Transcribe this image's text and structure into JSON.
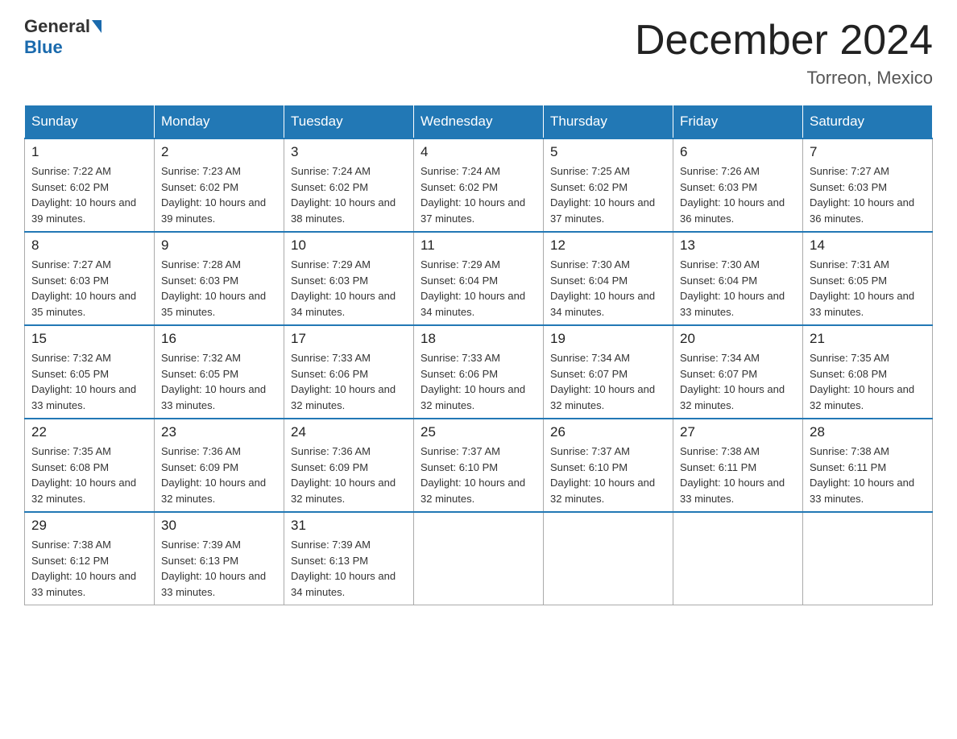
{
  "header": {
    "logo_general": "General",
    "logo_blue": "Blue",
    "month_title": "December 2024",
    "location": "Torreon, Mexico"
  },
  "weekdays": [
    "Sunday",
    "Monday",
    "Tuesday",
    "Wednesday",
    "Thursday",
    "Friday",
    "Saturday"
  ],
  "weeks": [
    [
      {
        "day": 1,
        "sunrise": "7:22 AM",
        "sunset": "6:02 PM",
        "daylight": "10 hours and 39 minutes."
      },
      {
        "day": 2,
        "sunrise": "7:23 AM",
        "sunset": "6:02 PM",
        "daylight": "10 hours and 39 minutes."
      },
      {
        "day": 3,
        "sunrise": "7:24 AM",
        "sunset": "6:02 PM",
        "daylight": "10 hours and 38 minutes."
      },
      {
        "day": 4,
        "sunrise": "7:24 AM",
        "sunset": "6:02 PM",
        "daylight": "10 hours and 37 minutes."
      },
      {
        "day": 5,
        "sunrise": "7:25 AM",
        "sunset": "6:02 PM",
        "daylight": "10 hours and 37 minutes."
      },
      {
        "day": 6,
        "sunrise": "7:26 AM",
        "sunset": "6:03 PM",
        "daylight": "10 hours and 36 minutes."
      },
      {
        "day": 7,
        "sunrise": "7:27 AM",
        "sunset": "6:03 PM",
        "daylight": "10 hours and 36 minutes."
      }
    ],
    [
      {
        "day": 8,
        "sunrise": "7:27 AM",
        "sunset": "6:03 PM",
        "daylight": "10 hours and 35 minutes."
      },
      {
        "day": 9,
        "sunrise": "7:28 AM",
        "sunset": "6:03 PM",
        "daylight": "10 hours and 35 minutes."
      },
      {
        "day": 10,
        "sunrise": "7:29 AM",
        "sunset": "6:03 PM",
        "daylight": "10 hours and 34 minutes."
      },
      {
        "day": 11,
        "sunrise": "7:29 AM",
        "sunset": "6:04 PM",
        "daylight": "10 hours and 34 minutes."
      },
      {
        "day": 12,
        "sunrise": "7:30 AM",
        "sunset": "6:04 PM",
        "daylight": "10 hours and 34 minutes."
      },
      {
        "day": 13,
        "sunrise": "7:30 AM",
        "sunset": "6:04 PM",
        "daylight": "10 hours and 33 minutes."
      },
      {
        "day": 14,
        "sunrise": "7:31 AM",
        "sunset": "6:05 PM",
        "daylight": "10 hours and 33 minutes."
      }
    ],
    [
      {
        "day": 15,
        "sunrise": "7:32 AM",
        "sunset": "6:05 PM",
        "daylight": "10 hours and 33 minutes."
      },
      {
        "day": 16,
        "sunrise": "7:32 AM",
        "sunset": "6:05 PM",
        "daylight": "10 hours and 33 minutes."
      },
      {
        "day": 17,
        "sunrise": "7:33 AM",
        "sunset": "6:06 PM",
        "daylight": "10 hours and 32 minutes."
      },
      {
        "day": 18,
        "sunrise": "7:33 AM",
        "sunset": "6:06 PM",
        "daylight": "10 hours and 32 minutes."
      },
      {
        "day": 19,
        "sunrise": "7:34 AM",
        "sunset": "6:07 PM",
        "daylight": "10 hours and 32 minutes."
      },
      {
        "day": 20,
        "sunrise": "7:34 AM",
        "sunset": "6:07 PM",
        "daylight": "10 hours and 32 minutes."
      },
      {
        "day": 21,
        "sunrise": "7:35 AM",
        "sunset": "6:08 PM",
        "daylight": "10 hours and 32 minutes."
      }
    ],
    [
      {
        "day": 22,
        "sunrise": "7:35 AM",
        "sunset": "6:08 PM",
        "daylight": "10 hours and 32 minutes."
      },
      {
        "day": 23,
        "sunrise": "7:36 AM",
        "sunset": "6:09 PM",
        "daylight": "10 hours and 32 minutes."
      },
      {
        "day": 24,
        "sunrise": "7:36 AM",
        "sunset": "6:09 PM",
        "daylight": "10 hours and 32 minutes."
      },
      {
        "day": 25,
        "sunrise": "7:37 AM",
        "sunset": "6:10 PM",
        "daylight": "10 hours and 32 minutes."
      },
      {
        "day": 26,
        "sunrise": "7:37 AM",
        "sunset": "6:10 PM",
        "daylight": "10 hours and 32 minutes."
      },
      {
        "day": 27,
        "sunrise": "7:38 AM",
        "sunset": "6:11 PM",
        "daylight": "10 hours and 33 minutes."
      },
      {
        "day": 28,
        "sunrise": "7:38 AM",
        "sunset": "6:11 PM",
        "daylight": "10 hours and 33 minutes."
      }
    ],
    [
      {
        "day": 29,
        "sunrise": "7:38 AM",
        "sunset": "6:12 PM",
        "daylight": "10 hours and 33 minutes."
      },
      {
        "day": 30,
        "sunrise": "7:39 AM",
        "sunset": "6:13 PM",
        "daylight": "10 hours and 33 minutes."
      },
      {
        "day": 31,
        "sunrise": "7:39 AM",
        "sunset": "6:13 PM",
        "daylight": "10 hours and 34 minutes."
      },
      null,
      null,
      null,
      null
    ]
  ]
}
